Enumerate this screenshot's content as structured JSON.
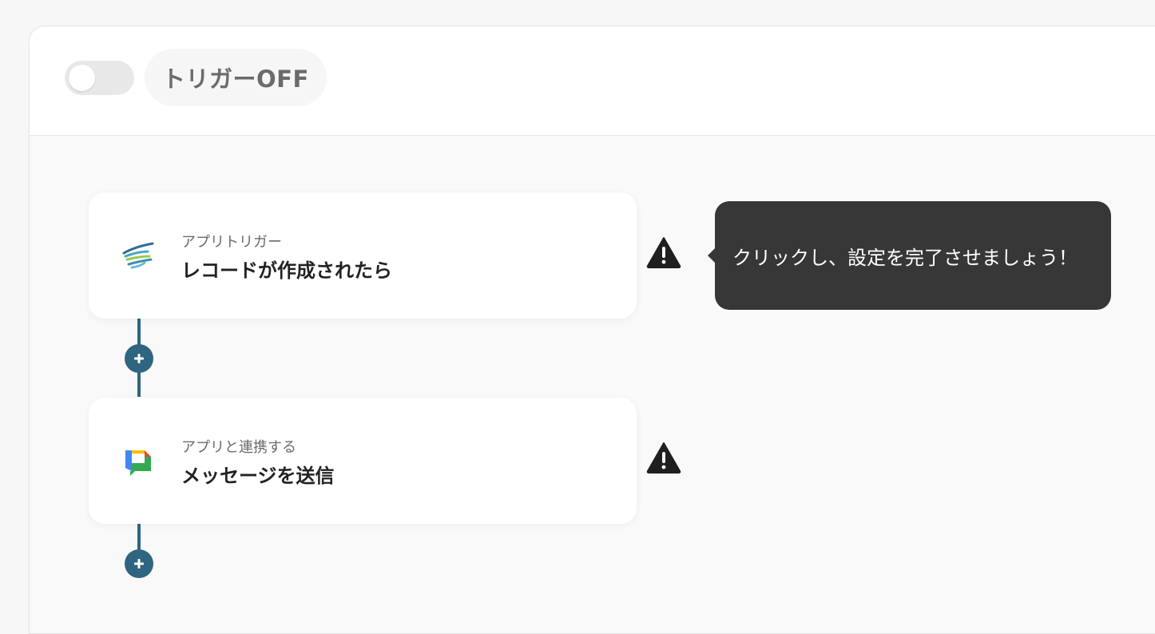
{
  "header": {
    "trigger_toggle": {
      "state": "off"
    },
    "trigger_status_label": "トリガーOFF"
  },
  "steps": [
    {
      "app_icon": "kintone-app-icon",
      "subtitle": "アプリトリガー",
      "title": "レコードが作成されたら",
      "status_icon": "warning-icon"
    },
    {
      "app_icon": "google-chat-app-icon",
      "subtitle": "アプリと連携する",
      "title": "メッセージを送信",
      "status_icon": "warning-icon"
    }
  ],
  "tooltip": {
    "text": "クリックし、設定を完了させましょう！"
  },
  "colors": {
    "connector": "#2f6580",
    "tooltip_bg": "#373737",
    "warning": "#1f1f1f"
  }
}
